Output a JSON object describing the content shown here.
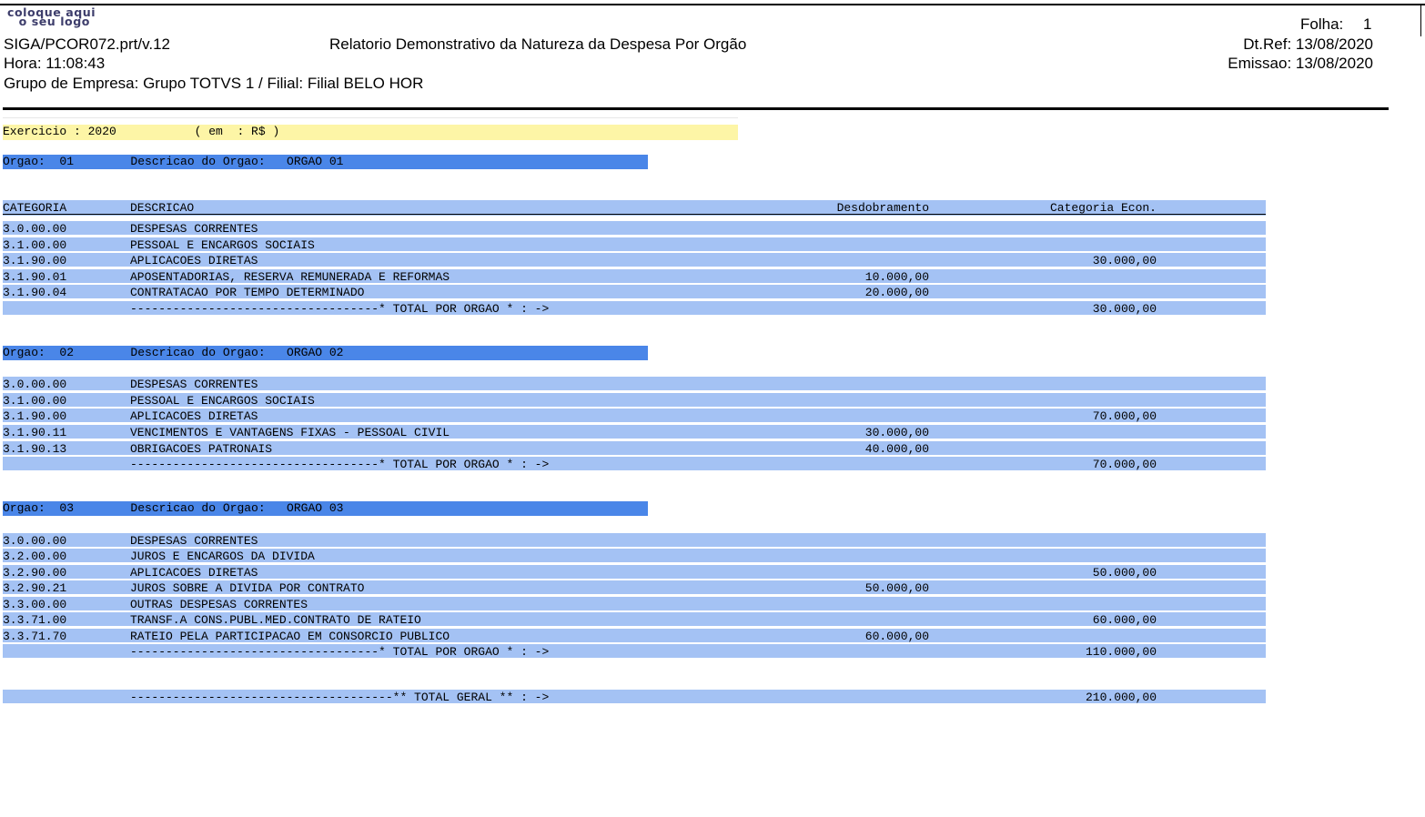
{
  "header": {
    "logo_line1": "coloque aqui",
    "logo_line2": "o seu logo",
    "program": "SIGA/PCOR072.prt/v.12",
    "title": "Relatorio Demonstrativo da Natureza da Despesa Por Orgão",
    "hora": "Hora: 11:08:43",
    "grupo": "Grupo de Empresa: Grupo TOTVS 1 / Filial: Filial BELO HOR",
    "folha_label": "Folha:",
    "folha_value": "1",
    "dtref": "Dt.Ref: 13/08/2020",
    "emissao": "Emissao: 13/08/2020"
  },
  "exercicio": "Exercicio : 2020           ( em  : R$ )",
  "columns": {
    "categoria": "CATEGORIA",
    "descricao": "DESCRICAO",
    "desdobramento": "Desdobramento",
    "categoria_econ": "Categoria Econ."
  },
  "orgaos": [
    {
      "label": "Orgao:  01        Descricao do Orgao:   ORGAO 01",
      "rows": [
        {
          "cat": "3.0.00.00",
          "desc": "DESPESAS CORRENTES",
          "des": "",
          "eco": ""
        },
        {
          "cat": "3.1.00.00",
          "desc": "PESSOAL E ENCARGOS SOCIAIS",
          "des": "",
          "eco": ""
        },
        {
          "cat": "3.1.90.00",
          "desc": "APLICACOES DIRETAS",
          "des": "",
          "eco": "30.000,00"
        },
        {
          "cat": "3.1.90.01",
          "desc": "APOSENTADORIAS, RESERVA REMUNERADA E REFORMAS",
          "des": "10.000,00",
          "eco": ""
        },
        {
          "cat": "3.1.90.04",
          "desc": "CONTRATACAO POR TEMPO DETERMINADO",
          "des": "20.000,00",
          "eco": ""
        }
      ],
      "total_label": "-----------------------------------* TOTAL POR ORGAO * : ->",
      "total_value": "30.000,00"
    },
    {
      "label": "Orgao:  02        Descricao do Orgao:   ORGAO 02",
      "rows": [
        {
          "cat": "3.0.00.00",
          "desc": "DESPESAS CORRENTES",
          "des": "",
          "eco": ""
        },
        {
          "cat": "3.1.00.00",
          "desc": "PESSOAL E ENCARGOS SOCIAIS",
          "des": "",
          "eco": ""
        },
        {
          "cat": "3.1.90.00",
          "desc": "APLICACOES DIRETAS",
          "des": "",
          "eco": "70.000,00"
        },
        {
          "cat": "3.1.90.11",
          "desc": "VENCIMENTOS E VANTAGENS FIXAS - PESSOAL CIVIL",
          "des": "30.000,00",
          "eco": ""
        },
        {
          "cat": "3.1.90.13",
          "desc": "OBRIGACOES PATRONAIS",
          "des": "40.000,00",
          "eco": ""
        }
      ],
      "total_label": "-----------------------------------* TOTAL POR ORGAO * : ->",
      "total_value": "70.000,00"
    },
    {
      "label": "Orgao:  03        Descricao do Orgao:   ORGAO 03",
      "rows": [
        {
          "cat": "3.0.00.00",
          "desc": "DESPESAS CORRENTES",
          "des": "",
          "eco": ""
        },
        {
          "cat": "3.2.00.00",
          "desc": "JUROS E ENCARGOS DA DIVIDA",
          "des": "",
          "eco": ""
        },
        {
          "cat": "3.2.90.00",
          "desc": "APLICACOES DIRETAS",
          "des": "",
          "eco": "50.000,00"
        },
        {
          "cat": "3.2.90.21",
          "desc": "JUROS SOBRE A DIVIDA POR CONTRATO",
          "des": "50.000,00",
          "eco": ""
        },
        {
          "cat": "3.3.00.00",
          "desc": "OUTRAS DESPESAS CORRENTES",
          "des": "",
          "eco": ""
        },
        {
          "cat": "3.3.71.00",
          "desc": "TRANSF.A CONS.PUBL.MED.CONTRATO DE RATEIO",
          "des": "",
          "eco": "60.000,00"
        },
        {
          "cat": "3.3.71.70",
          "desc": "RATEIO PELA PARTICIPACAO EM CONSORCIO PUBLICO",
          "des": "60.000,00",
          "eco": ""
        }
      ],
      "total_label": "-----------------------------------* TOTAL POR ORGAO * : ->",
      "total_value": "110.000,00"
    }
  ],
  "total_geral": {
    "label": "-------------------------------------** TOTAL GERAL ** : ->",
    "value": "210.000,00"
  },
  "colors": {
    "org_bar": "#4a86e8",
    "row_band": "#a4c2f4",
    "exercicio_band": "#fdf5a6"
  }
}
